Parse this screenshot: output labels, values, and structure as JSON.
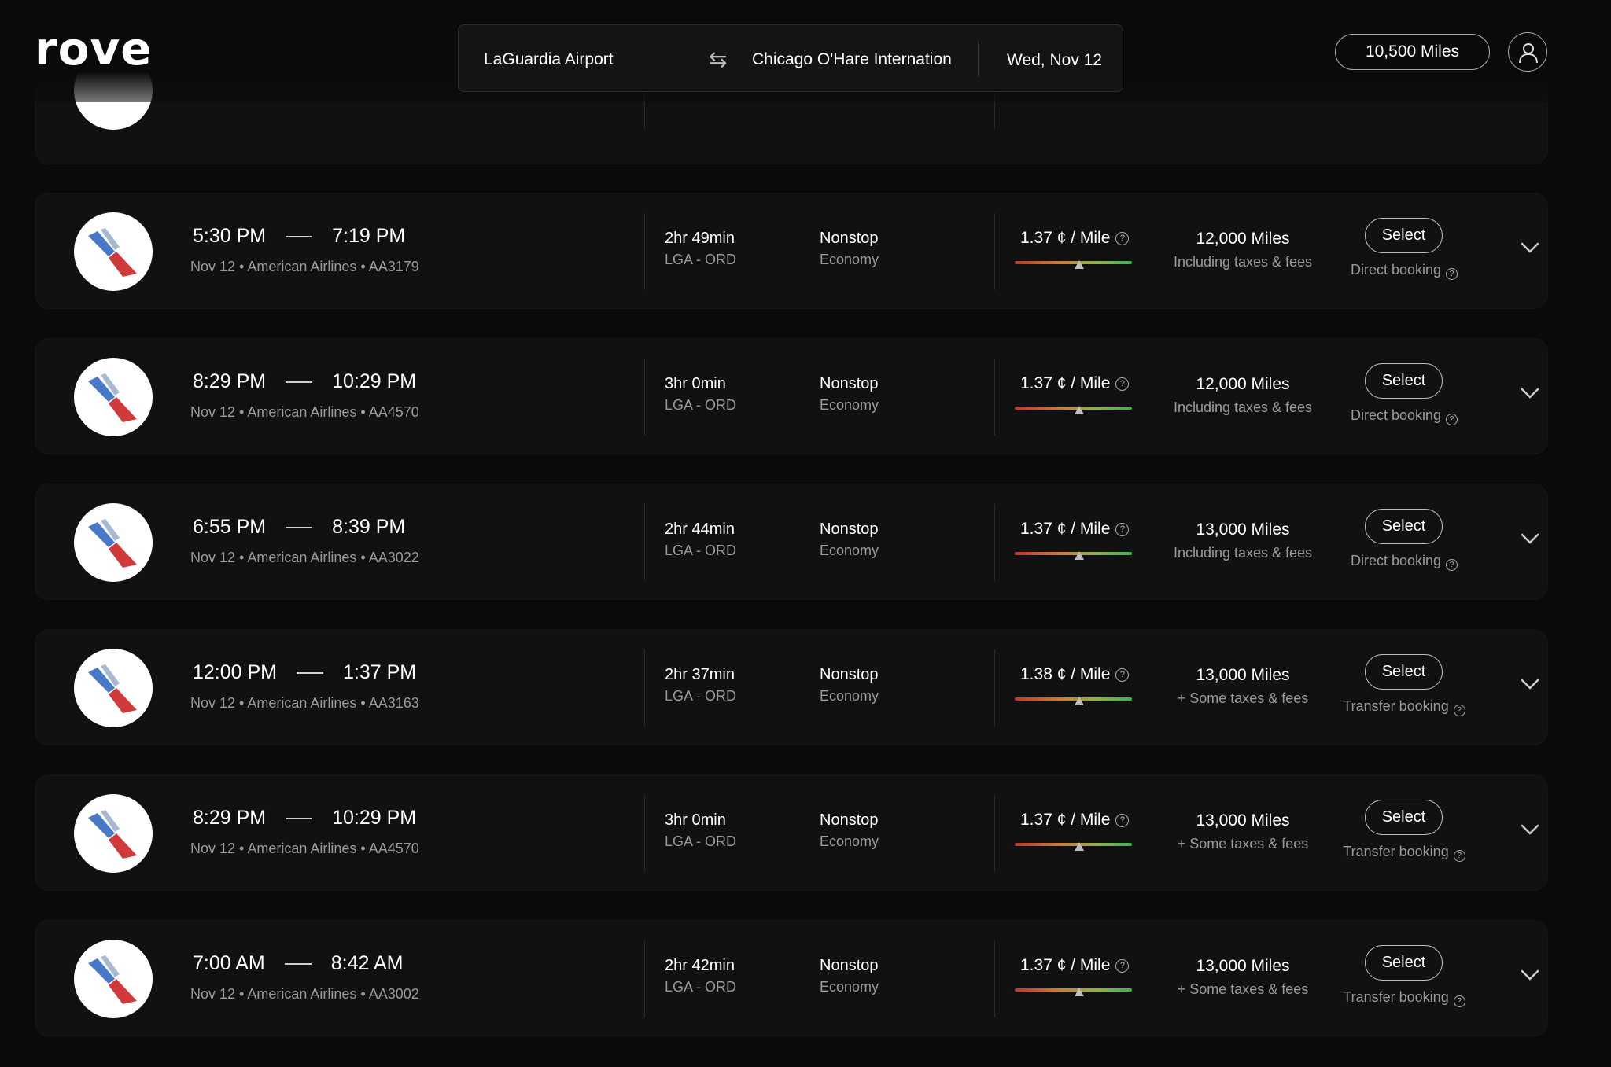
{
  "app": {
    "logo": "rove"
  },
  "search": {
    "from": "LaGuardia Airport",
    "to": "Chicago O'Hare Internation",
    "date": "Wed, Nov 12"
  },
  "header": {
    "miles_balance": "10,500 Miles"
  },
  "icons": {
    "swap": "swap-arrows-icon",
    "help": "question-circle-icon",
    "expand": "chevron-down-icon",
    "profile": "user-icon",
    "airline": "american-airlines-logo"
  },
  "colors": {
    "background": "#0a0a0a",
    "card": "#111111",
    "gauge_low": "#c0392b",
    "gauge_high": "#3fae5a"
  },
  "flights": [
    {
      "depart": "5:30 PM",
      "arrive": "7:19 PM",
      "date": "Nov 12",
      "airline": "American Airlines",
      "flight": "AA3179",
      "duration": "2hr 49min",
      "route": "LGA - ORD",
      "stops": "Nonstop",
      "cabin": "Economy",
      "cpm": "1.37 ¢ / Mile",
      "gauge": 0.55,
      "miles": "12,000 Miles",
      "taxes": "Including taxes & fees",
      "select": "Select",
      "booking": "Direct booking"
    },
    {
      "depart": "8:29 PM",
      "arrive": "10:29 PM",
      "date": "Nov 12",
      "airline": "American Airlines",
      "flight": "AA4570",
      "duration": "3hr 0min",
      "route": "LGA - ORD",
      "stops": "Nonstop",
      "cabin": "Economy",
      "cpm": "1.37 ¢ / Mile",
      "gauge": 0.55,
      "miles": "12,000 Miles",
      "taxes": "Including taxes & fees",
      "select": "Select",
      "booking": "Direct booking"
    },
    {
      "depart": "6:55 PM",
      "arrive": "8:39 PM",
      "date": "Nov 12",
      "airline": "American Airlines",
      "flight": "AA3022",
      "duration": "2hr 44min",
      "route": "LGA - ORD",
      "stops": "Nonstop",
      "cabin": "Economy",
      "cpm": "1.37 ¢ / Mile",
      "gauge": 0.55,
      "miles": "13,000 Miles",
      "taxes": "Including taxes & fees",
      "select": "Select",
      "booking": "Direct booking"
    },
    {
      "depart": "12:00 PM",
      "arrive": "1:37 PM",
      "date": "Nov 12",
      "airline": "American Airlines",
      "flight": "AA3163",
      "duration": "2hr 37min",
      "route": "LGA - ORD",
      "stops": "Nonstop",
      "cabin": "Economy",
      "cpm": "1.38 ¢ / Mile",
      "gauge": 0.55,
      "miles": "13,000 Miles",
      "taxes": "+ Some taxes & fees",
      "select": "Select",
      "booking": "Transfer booking"
    },
    {
      "depart": "8:29 PM",
      "arrive": "10:29 PM",
      "date": "Nov 12",
      "airline": "American Airlines",
      "flight": "AA4570",
      "duration": "3hr 0min",
      "route": "LGA - ORD",
      "stops": "Nonstop",
      "cabin": "Economy",
      "cpm": "1.37 ¢ / Mile",
      "gauge": 0.55,
      "miles": "13,000 Miles",
      "taxes": "+ Some taxes & fees",
      "select": "Select",
      "booking": "Transfer booking"
    },
    {
      "depart": "7:00 AM",
      "arrive": "8:42 AM",
      "date": "Nov 12",
      "airline": "American Airlines",
      "flight": "AA3002",
      "duration": "2hr 42min",
      "route": "LGA - ORD",
      "stops": "Nonstop",
      "cabin": "Economy",
      "cpm": "1.37 ¢ / Mile",
      "gauge": 0.55,
      "miles": "13,000 Miles",
      "taxes": "+ Some taxes & fees",
      "select": "Select",
      "booking": "Transfer booking"
    }
  ]
}
